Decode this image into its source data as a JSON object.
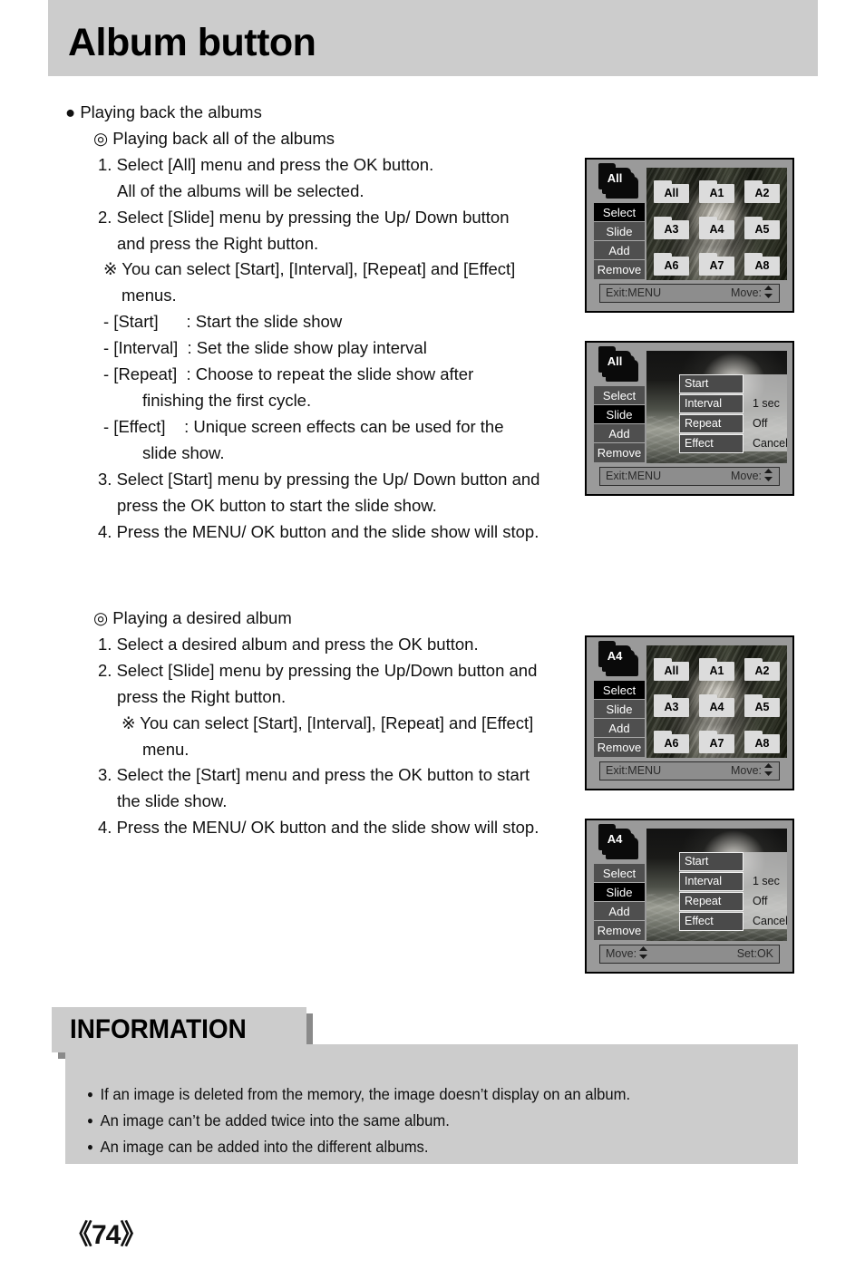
{
  "page": {
    "title": "Album button",
    "number": "《74》"
  },
  "content": {
    "section1": {
      "heading": "● Playing back the albums",
      "subheading": "◎ Playing back all of the albums",
      "lines": [
        "1. Select [All] menu and press the OK button.",
        "All of the albums will be selected.",
        "2. Select [Slide] menu by pressing the Up/ Down button",
        "and press the Right button.",
        "※ You can select [Start], [Interval], [Repeat] and [Effect]",
        "menus.",
        "- [Start]      : Start the slide show",
        "- [Interval]  : Set the slide show play interval",
        "- [Repeat]  : Choose to repeat the slide show after",
        "finishing the first cycle.",
        "- [Effect]    : Unique screen effects can be used for the",
        "slide show.",
        "3. Select [Start] menu by pressing the Up/ Down button and",
        "press the OK button to start the slide show.",
        "4. Press the MENU/ OK button and the slide show will stop."
      ]
    },
    "section2": {
      "subheading": "◎ Playing a desired album",
      "lines": [
        "1. Select a desired album and press the OK button.",
        "2. Select [Slide] menu by pressing the Up/Down button and",
        "press the Right button.",
        "※ You can select [Start], [Interval], [Repeat] and [Effect]",
        "menu.",
        "3. Select the [Start] menu and press the OK button to start",
        "the slide show.",
        "4. Press the MENU/ OK button and the slide show will stop."
      ]
    }
  },
  "lcd_screens": [
    {
      "album_icon_label": "All",
      "menu": [
        {
          "label": "Select",
          "selected": true
        },
        {
          "label": "Slide",
          "selected": false
        },
        {
          "label": "Add",
          "selected": false
        },
        {
          "label": "Remove",
          "selected": false
        }
      ],
      "tiles": [
        "All",
        "A1",
        "A2",
        "A3",
        "A4",
        "A5",
        "A6",
        "A7",
        "A8"
      ],
      "status_left": "Exit:MENU",
      "status_right": "Move:"
    },
    {
      "album_icon_label": "All",
      "menu": [
        {
          "label": "Select",
          "selected": false
        },
        {
          "label": "Slide",
          "selected": true
        },
        {
          "label": "Add",
          "selected": false
        },
        {
          "label": "Remove",
          "selected": false
        }
      ],
      "submenu": [
        {
          "key": "Start",
          "value": ""
        },
        {
          "key": "Interval",
          "value": "1 sec"
        },
        {
          "key": "Repeat",
          "value": "Off"
        },
        {
          "key": "Effect",
          "value": "Cancel"
        }
      ],
      "status_left": "Exit:MENU",
      "status_right": "Move:"
    },
    {
      "album_icon_label": "A4",
      "menu": [
        {
          "label": "Select",
          "selected": true
        },
        {
          "label": "Slide",
          "selected": false
        },
        {
          "label": "Add",
          "selected": false
        },
        {
          "label": "Remove",
          "selected": false
        }
      ],
      "tiles": [
        "All",
        "A1",
        "A2",
        "A3",
        "A4",
        "A5",
        "A6",
        "A7",
        "A8"
      ],
      "status_left": "Exit:MENU",
      "status_right": "Move:"
    },
    {
      "album_icon_label": "A4",
      "menu": [
        {
          "label": "Select",
          "selected": false
        },
        {
          "label": "Slide",
          "selected": true
        },
        {
          "label": "Add",
          "selected": false
        },
        {
          "label": "Remove",
          "selected": false
        }
      ],
      "submenu": [
        {
          "key": "Start",
          "value": ""
        },
        {
          "key": "Interval",
          "value": "1 sec"
        },
        {
          "key": "Repeat",
          "value": "Off"
        },
        {
          "key": "Effect",
          "value": "Cancel"
        }
      ],
      "status_left": "Move:",
      "status_right": "Set:OK"
    }
  ],
  "information": {
    "title": "INFORMATION",
    "items": [
      "If an image is deleted from the memory, the image doesn’t display on an album.",
      "An image can’t be added twice into the same album.",
      "An image can be added into the different albums."
    ]
  },
  "colors": {
    "band_gray": "#cccccc",
    "shadow_gray": "#8a8a8a",
    "lcd_body": "#9a9a9a",
    "menu_item": "#4f4f4f",
    "menu_selected": "#000000"
  }
}
